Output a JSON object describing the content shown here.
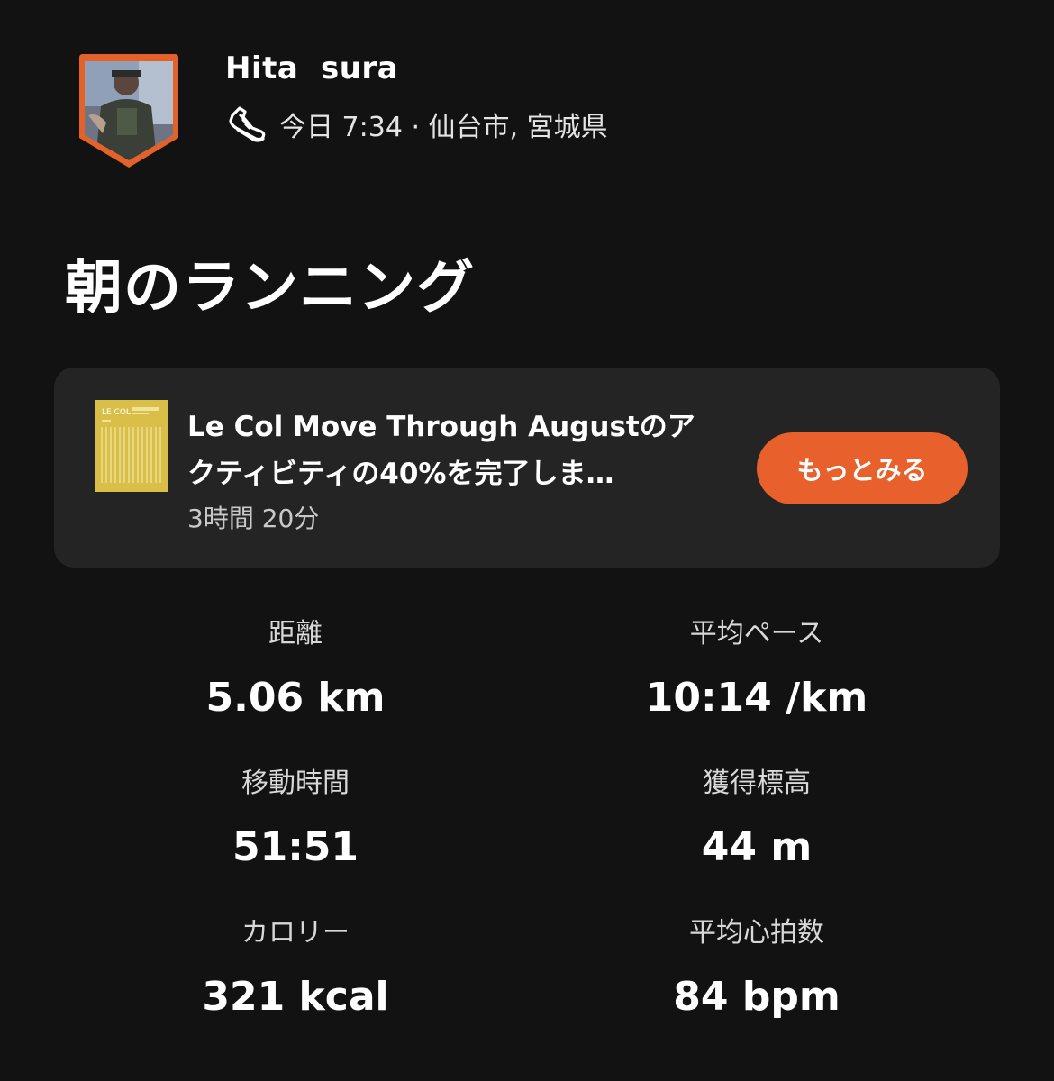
{
  "header": {
    "athlete_name": "Hita  sura",
    "activity_icon": "running-shoe-icon",
    "meta_text": "今日 7:34 · 仙台市, 宮城県"
  },
  "activity": {
    "title": "朝のランニング"
  },
  "challenge": {
    "title_line1": "Le Col Move Through Augustのア",
    "title_line2": "クティビティの40%を完了しま…",
    "time": "3時間 20分",
    "button_label": "もっとみる",
    "badge_icon": "challenge-badge-icon",
    "badge_text": "LE COL",
    "colors": {
      "button": "#e8602b",
      "badge": "#d9be48",
      "card": "#242424"
    }
  },
  "stats": {
    "distance": {
      "label": "距離",
      "value": "5.06 km"
    },
    "avg_pace": {
      "label": "平均ペース",
      "value": "10:14 /km"
    },
    "moving_time": {
      "label": "移動時間",
      "value": "51:51"
    },
    "elevation_gain": {
      "label": "獲得標高",
      "value": "44 m"
    },
    "calories": {
      "label": "カロリー",
      "value": "321 kcal"
    },
    "avg_heart_rate": {
      "label": "平均心拍数",
      "value": "84 bpm"
    }
  },
  "colors": {
    "background": "#121212",
    "accent": "#e8602b"
  }
}
